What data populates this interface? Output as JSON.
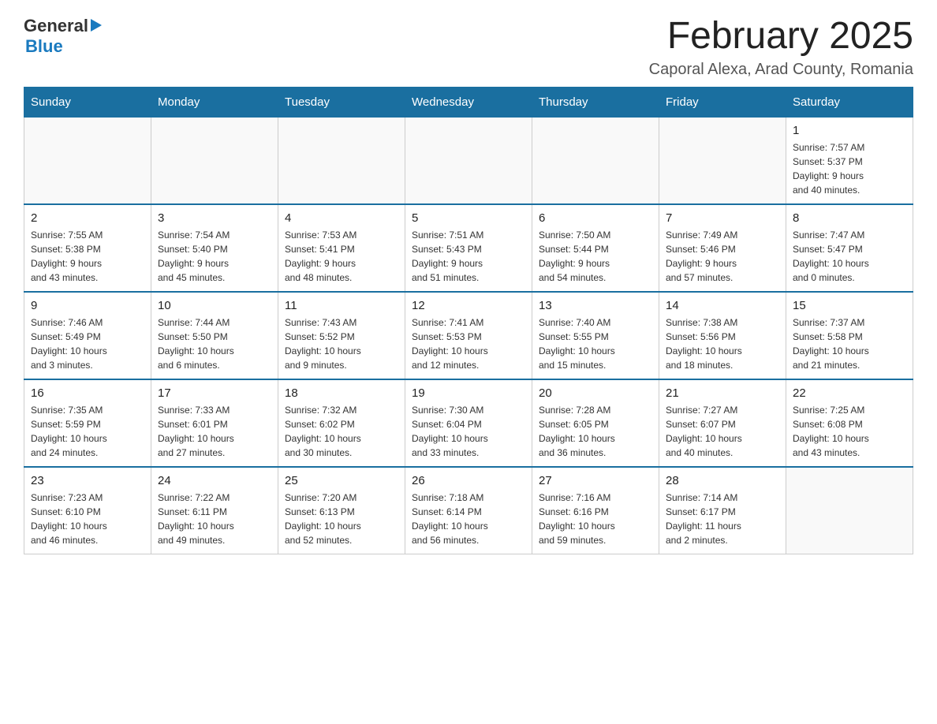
{
  "header": {
    "logo_general": "General",
    "logo_blue": "Blue",
    "month_title": "February 2025",
    "location": "Caporal Alexa, Arad County, Romania"
  },
  "weekdays": [
    "Sunday",
    "Monday",
    "Tuesday",
    "Wednesday",
    "Thursday",
    "Friday",
    "Saturday"
  ],
  "weeks": [
    [
      {
        "day": "",
        "info": ""
      },
      {
        "day": "",
        "info": ""
      },
      {
        "day": "",
        "info": ""
      },
      {
        "day": "",
        "info": ""
      },
      {
        "day": "",
        "info": ""
      },
      {
        "day": "",
        "info": ""
      },
      {
        "day": "1",
        "info": "Sunrise: 7:57 AM\nSunset: 5:37 PM\nDaylight: 9 hours\nand 40 minutes."
      }
    ],
    [
      {
        "day": "2",
        "info": "Sunrise: 7:55 AM\nSunset: 5:38 PM\nDaylight: 9 hours\nand 43 minutes."
      },
      {
        "day": "3",
        "info": "Sunrise: 7:54 AM\nSunset: 5:40 PM\nDaylight: 9 hours\nand 45 minutes."
      },
      {
        "day": "4",
        "info": "Sunrise: 7:53 AM\nSunset: 5:41 PM\nDaylight: 9 hours\nand 48 minutes."
      },
      {
        "day": "5",
        "info": "Sunrise: 7:51 AM\nSunset: 5:43 PM\nDaylight: 9 hours\nand 51 minutes."
      },
      {
        "day": "6",
        "info": "Sunrise: 7:50 AM\nSunset: 5:44 PM\nDaylight: 9 hours\nand 54 minutes."
      },
      {
        "day": "7",
        "info": "Sunrise: 7:49 AM\nSunset: 5:46 PM\nDaylight: 9 hours\nand 57 minutes."
      },
      {
        "day": "8",
        "info": "Sunrise: 7:47 AM\nSunset: 5:47 PM\nDaylight: 10 hours\nand 0 minutes."
      }
    ],
    [
      {
        "day": "9",
        "info": "Sunrise: 7:46 AM\nSunset: 5:49 PM\nDaylight: 10 hours\nand 3 minutes."
      },
      {
        "day": "10",
        "info": "Sunrise: 7:44 AM\nSunset: 5:50 PM\nDaylight: 10 hours\nand 6 minutes."
      },
      {
        "day": "11",
        "info": "Sunrise: 7:43 AM\nSunset: 5:52 PM\nDaylight: 10 hours\nand 9 minutes."
      },
      {
        "day": "12",
        "info": "Sunrise: 7:41 AM\nSunset: 5:53 PM\nDaylight: 10 hours\nand 12 minutes."
      },
      {
        "day": "13",
        "info": "Sunrise: 7:40 AM\nSunset: 5:55 PM\nDaylight: 10 hours\nand 15 minutes."
      },
      {
        "day": "14",
        "info": "Sunrise: 7:38 AM\nSunset: 5:56 PM\nDaylight: 10 hours\nand 18 minutes."
      },
      {
        "day": "15",
        "info": "Sunrise: 7:37 AM\nSunset: 5:58 PM\nDaylight: 10 hours\nand 21 minutes."
      }
    ],
    [
      {
        "day": "16",
        "info": "Sunrise: 7:35 AM\nSunset: 5:59 PM\nDaylight: 10 hours\nand 24 minutes."
      },
      {
        "day": "17",
        "info": "Sunrise: 7:33 AM\nSunset: 6:01 PM\nDaylight: 10 hours\nand 27 minutes."
      },
      {
        "day": "18",
        "info": "Sunrise: 7:32 AM\nSunset: 6:02 PM\nDaylight: 10 hours\nand 30 minutes."
      },
      {
        "day": "19",
        "info": "Sunrise: 7:30 AM\nSunset: 6:04 PM\nDaylight: 10 hours\nand 33 minutes."
      },
      {
        "day": "20",
        "info": "Sunrise: 7:28 AM\nSunset: 6:05 PM\nDaylight: 10 hours\nand 36 minutes."
      },
      {
        "day": "21",
        "info": "Sunrise: 7:27 AM\nSunset: 6:07 PM\nDaylight: 10 hours\nand 40 minutes."
      },
      {
        "day": "22",
        "info": "Sunrise: 7:25 AM\nSunset: 6:08 PM\nDaylight: 10 hours\nand 43 minutes."
      }
    ],
    [
      {
        "day": "23",
        "info": "Sunrise: 7:23 AM\nSunset: 6:10 PM\nDaylight: 10 hours\nand 46 minutes."
      },
      {
        "day": "24",
        "info": "Sunrise: 7:22 AM\nSunset: 6:11 PM\nDaylight: 10 hours\nand 49 minutes."
      },
      {
        "day": "25",
        "info": "Sunrise: 7:20 AM\nSunset: 6:13 PM\nDaylight: 10 hours\nand 52 minutes."
      },
      {
        "day": "26",
        "info": "Sunrise: 7:18 AM\nSunset: 6:14 PM\nDaylight: 10 hours\nand 56 minutes."
      },
      {
        "day": "27",
        "info": "Sunrise: 7:16 AM\nSunset: 6:16 PM\nDaylight: 10 hours\nand 59 minutes."
      },
      {
        "day": "28",
        "info": "Sunrise: 7:14 AM\nSunset: 6:17 PM\nDaylight: 11 hours\nand 2 minutes."
      },
      {
        "day": "",
        "info": ""
      }
    ]
  ]
}
